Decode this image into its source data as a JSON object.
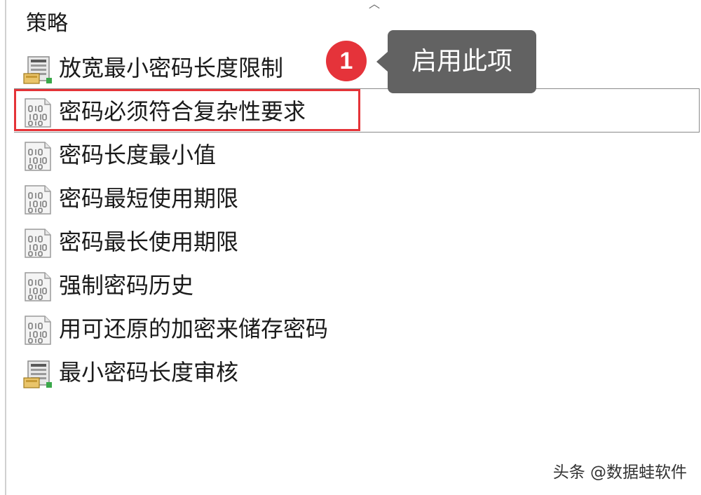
{
  "header": {
    "column_title": "策略"
  },
  "policies": [
    {
      "label": "放宽最小密码长度限制",
      "icon": "policy-enabled-icon"
    },
    {
      "label": "密码必须符合复杂性要求",
      "icon": "policy-binary-icon",
      "selected": true
    },
    {
      "label": "密码长度最小值",
      "icon": "policy-binary-icon"
    },
    {
      "label": "密码最短使用期限",
      "icon": "policy-binary-icon"
    },
    {
      "label": "密码最长使用期限",
      "icon": "policy-binary-icon"
    },
    {
      "label": "强制密码历史",
      "icon": "policy-binary-icon"
    },
    {
      "label": "用可还原的加密来储存密码",
      "icon": "policy-binary-icon"
    },
    {
      "label": "最小密码长度审核",
      "icon": "policy-enabled-icon"
    }
  ],
  "annotation": {
    "step_number": "1",
    "tooltip_text": "启用此项",
    "highlight_color": "#e53338",
    "badge_color": "#e5333a",
    "tooltip_color": "#626262"
  },
  "watermark": "头条 @数据蛙软件"
}
